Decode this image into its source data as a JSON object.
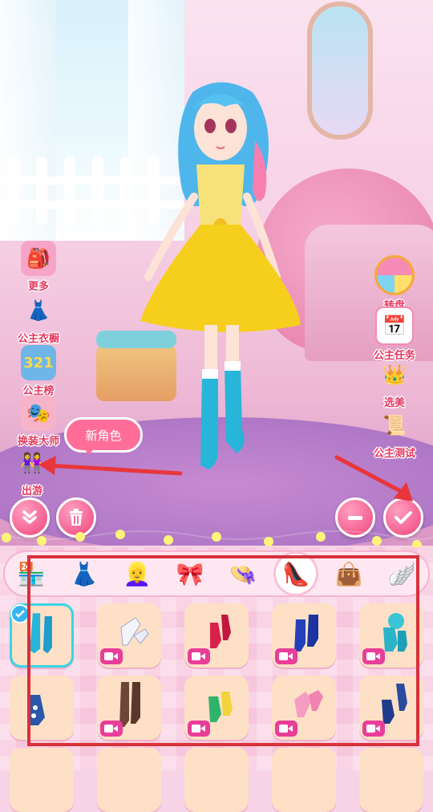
{
  "left_menu": [
    {
      "label": "更多",
      "icon": "backpack-icon"
    },
    {
      "label": "公主衣橱",
      "icon": "wardrobe-icon"
    },
    {
      "label": "公主榜",
      "icon": "ranking-icon"
    },
    {
      "label": "换装大师",
      "icon": "curtain-stage-icon"
    },
    {
      "label": "出游",
      "icon": "travel-girls-icon"
    }
  ],
  "right_menu": [
    {
      "label": "转盘",
      "icon": "wheel-icon"
    },
    {
      "label": "公主任务",
      "icon": "calendar-icon"
    },
    {
      "label": "选美",
      "icon": "crown-icon"
    },
    {
      "label": "公主测试",
      "icon": "quill-icon"
    }
  ],
  "tooltip": {
    "text": "新角色"
  },
  "categories": [
    "shop-icon",
    "dress-icon",
    "hair-icon",
    "accessory-icon",
    "hat-icon",
    "shoes-icon",
    "bag-icon",
    "wings-icon"
  ],
  "active_category": 5,
  "items": [
    {
      "icon": "blue-boots",
      "selected": true,
      "video": false
    },
    {
      "icon": "white-heels",
      "selected": false,
      "video": true
    },
    {
      "icon": "red-heels",
      "selected": false,
      "video": true
    },
    {
      "icon": "blue-platform-heels",
      "selected": false,
      "video": true
    },
    {
      "icon": "teal-flower-heels",
      "selected": false,
      "video": true
    },
    {
      "icon": "blue-pattern-heel",
      "selected": false,
      "video": false
    },
    {
      "icon": "brown-boots",
      "selected": false,
      "video": true
    },
    {
      "icon": "green-heels",
      "selected": false,
      "video": true
    },
    {
      "icon": "pink-heels",
      "selected": false,
      "video": true
    },
    {
      "icon": "navy-heels",
      "selected": false,
      "video": true
    }
  ],
  "colors": {
    "accent": "#f0457d",
    "label": "#e7385f",
    "selected": "#38d5e5",
    "annotation": "#d7313a"
  }
}
